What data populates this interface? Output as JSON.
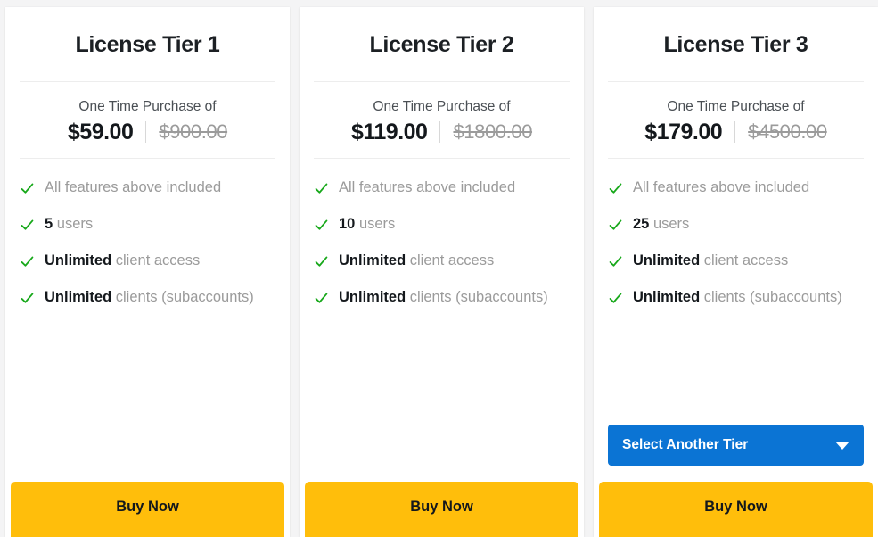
{
  "cards": [
    {
      "title": "License Tier 1",
      "price_caption": "One Time Purchase of",
      "price_current": "$59.00",
      "price_old": "$900.00",
      "features": [
        {
          "strong": "",
          "text": "All features above included"
        },
        {
          "strong": "5",
          "text": " users"
        },
        {
          "strong": "Unlimited",
          "text": " client access"
        },
        {
          "strong": "Unlimited",
          "text": " clients (subaccounts)"
        }
      ],
      "select_label": null,
      "buy_label": "Buy Now"
    },
    {
      "title": "License Tier 2",
      "price_caption": "One Time Purchase of",
      "price_current": "$119.00",
      "price_old": "$1800.00",
      "features": [
        {
          "strong": "",
          "text": "All features above included"
        },
        {
          "strong": "10",
          "text": " users"
        },
        {
          "strong": "Unlimited",
          "text": " client access"
        },
        {
          "strong": "Unlimited",
          "text": " clients (subaccounts)"
        }
      ],
      "select_label": null,
      "buy_label": "Buy Now"
    },
    {
      "title": "License Tier 3",
      "price_caption": "One Time Purchase of",
      "price_current": "$179.00",
      "price_old": "$4500.00",
      "features": [
        {
          "strong": "",
          "text": "All features above included"
        },
        {
          "strong": "25",
          "text": " users"
        },
        {
          "strong": "Unlimited",
          "text": " client access"
        },
        {
          "strong": "Unlimited",
          "text": " clients (subaccounts)"
        }
      ],
      "select_label": "Select Another Tier",
      "buy_label": "Buy Now"
    }
  ],
  "icons": {
    "check": "check-icon",
    "caret": "chevron-down-icon"
  },
  "colors": {
    "accent_blue": "#0b74d4",
    "accent_amber": "#ffbe0b",
    "check_green": "#17a81a",
    "muted_text": "#9b9b9b",
    "strong_text": "#14181c",
    "page_background": "#f4f4f5",
    "card_background": "#ffffff",
    "divider": "#ededed"
  }
}
